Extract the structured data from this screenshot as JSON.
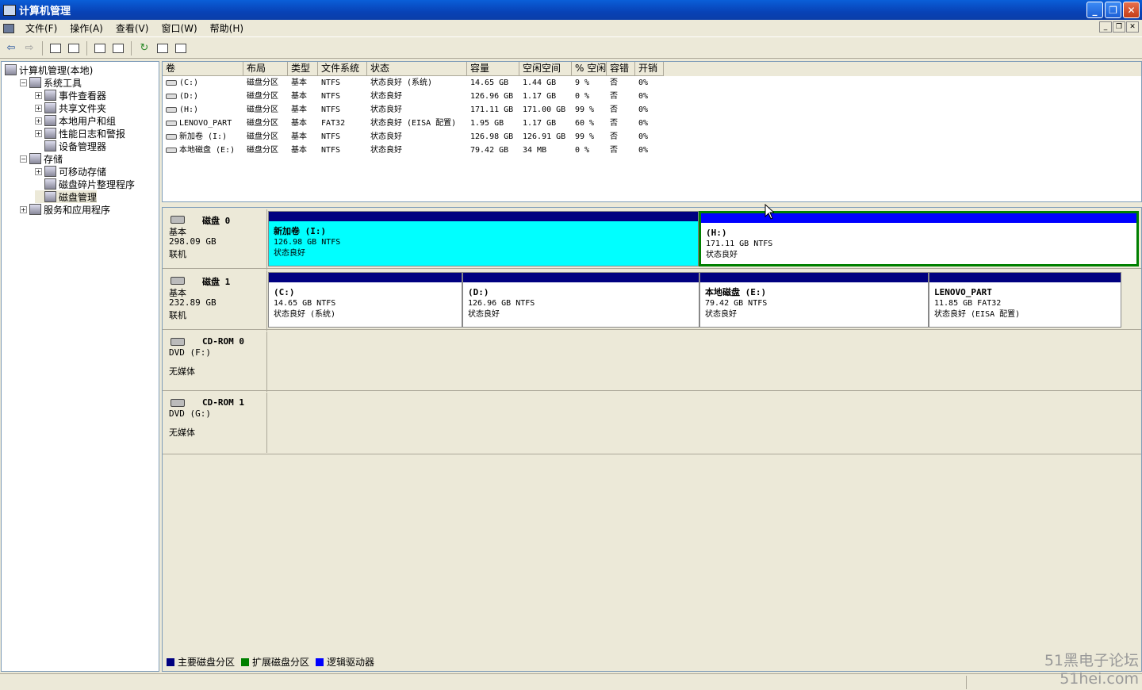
{
  "window": {
    "title": "计算机管理"
  },
  "menu": [
    "文件(F)",
    "操作(A)",
    "查看(V)",
    "窗口(W)",
    "帮助(H)"
  ],
  "tree": [
    {
      "label": "计算机管理(本地)",
      "level": 0,
      "exp": ""
    },
    {
      "label": "系统工具",
      "level": 1,
      "exp": "−"
    },
    {
      "label": "事件查看器",
      "level": 2,
      "exp": "+"
    },
    {
      "label": "共享文件夹",
      "level": 2,
      "exp": "+"
    },
    {
      "label": "本地用户和组",
      "level": 2,
      "exp": "+"
    },
    {
      "label": "性能日志和警报",
      "level": 2,
      "exp": "+"
    },
    {
      "label": "设备管理器",
      "level": 2,
      "exp": ""
    },
    {
      "label": "存储",
      "level": 1,
      "exp": "−"
    },
    {
      "label": "可移动存储",
      "level": 2,
      "exp": "+"
    },
    {
      "label": "磁盘碎片整理程序",
      "level": 2,
      "exp": ""
    },
    {
      "label": "磁盘管理",
      "level": 2,
      "exp": "",
      "selected": true
    },
    {
      "label": "服务和应用程序",
      "level": 1,
      "exp": "+"
    }
  ],
  "volume_columns": [
    "卷",
    "布局",
    "类型",
    "文件系统",
    "状态",
    "容量",
    "空闲空间",
    "% 空闲",
    "容错",
    "开销"
  ],
  "volumes": [
    [
      "(C:)",
      "磁盘分区",
      "基本",
      "NTFS",
      "状态良好 (系统)",
      "14.65 GB",
      "1.44 GB",
      "9 %",
      "否",
      "0%"
    ],
    [
      "(D:)",
      "磁盘分区",
      "基本",
      "NTFS",
      "状态良好",
      "126.96 GB",
      "1.17 GB",
      "0 %",
      "否",
      "0%"
    ],
    [
      "(H:)",
      "磁盘分区",
      "基本",
      "NTFS",
      "状态良好",
      "171.11 GB",
      "171.00 GB",
      "99 %",
      "否",
      "0%"
    ],
    [
      "LENOVO_PART",
      "磁盘分区",
      "基本",
      "FAT32",
      "状态良好 (EISA 配置)",
      "1.95 GB",
      "1.17 GB",
      "60 %",
      "否",
      "0%"
    ],
    [
      "新加卷 (I:)",
      "磁盘分区",
      "基本",
      "NTFS",
      "状态良好",
      "126.98 GB",
      "126.91 GB",
      "99 %",
      "否",
      "0%"
    ],
    [
      "本地磁盘 (E:)",
      "磁盘分区",
      "基本",
      "NTFS",
      "状态良好",
      "79.42 GB",
      "34 MB",
      "0 %",
      "否",
      "0%"
    ]
  ],
  "disks": [
    {
      "name": "磁盘 0",
      "type": "基本",
      "size": "298.09 GB",
      "status": "联机",
      "partitions": [
        {
          "name": "新加卷 (I:)",
          "detail": "126.98 GB NTFS",
          "status": "状态良好",
          "kind": "primary",
          "selected": true
        },
        {
          "name": "(H:)",
          "detail": "171.11 GB NTFS",
          "status": "状态良好",
          "kind": "logical"
        }
      ]
    },
    {
      "name": "磁盘 1",
      "type": "基本",
      "size": "232.89 GB",
      "status": "联机",
      "partitions": [
        {
          "name": "(C:)",
          "detail": "14.65 GB NTFS",
          "status": "状态良好 (系统)",
          "kind": "primary"
        },
        {
          "name": "(D:)",
          "detail": "126.96 GB NTFS",
          "status": "状态良好",
          "kind": "primary"
        },
        {
          "name": "本地磁盘 (E:)",
          "detail": "79.42 GB NTFS",
          "status": "状态良好",
          "kind": "primary"
        },
        {
          "name": "LENOVO_PART",
          "detail": "11.85 GB FAT32",
          "status": "状态良好 (EISA 配置)",
          "kind": "primary"
        }
      ]
    },
    {
      "name": "CD-ROM 0",
      "type": "DVD (F:)",
      "size": "",
      "status": "无媒体",
      "partitions": []
    },
    {
      "name": "CD-ROM 1",
      "type": "DVD (G:)",
      "size": "",
      "status": "无媒体",
      "partitions": []
    }
  ],
  "legend": [
    {
      "label": "主要磁盘分区",
      "color": "#000080"
    },
    {
      "label": "扩展磁盘分区",
      "color": "#008000"
    },
    {
      "label": "逻辑驱动器",
      "color": "#0000ff"
    }
  ],
  "watermark": {
    "line1": "51黑电子论坛",
    "line2": "51hei.com"
  },
  "colors": {
    "primary": "#000080",
    "logical": "#0000ff",
    "extended": "#008000",
    "selected_fill": "#00ffff"
  }
}
